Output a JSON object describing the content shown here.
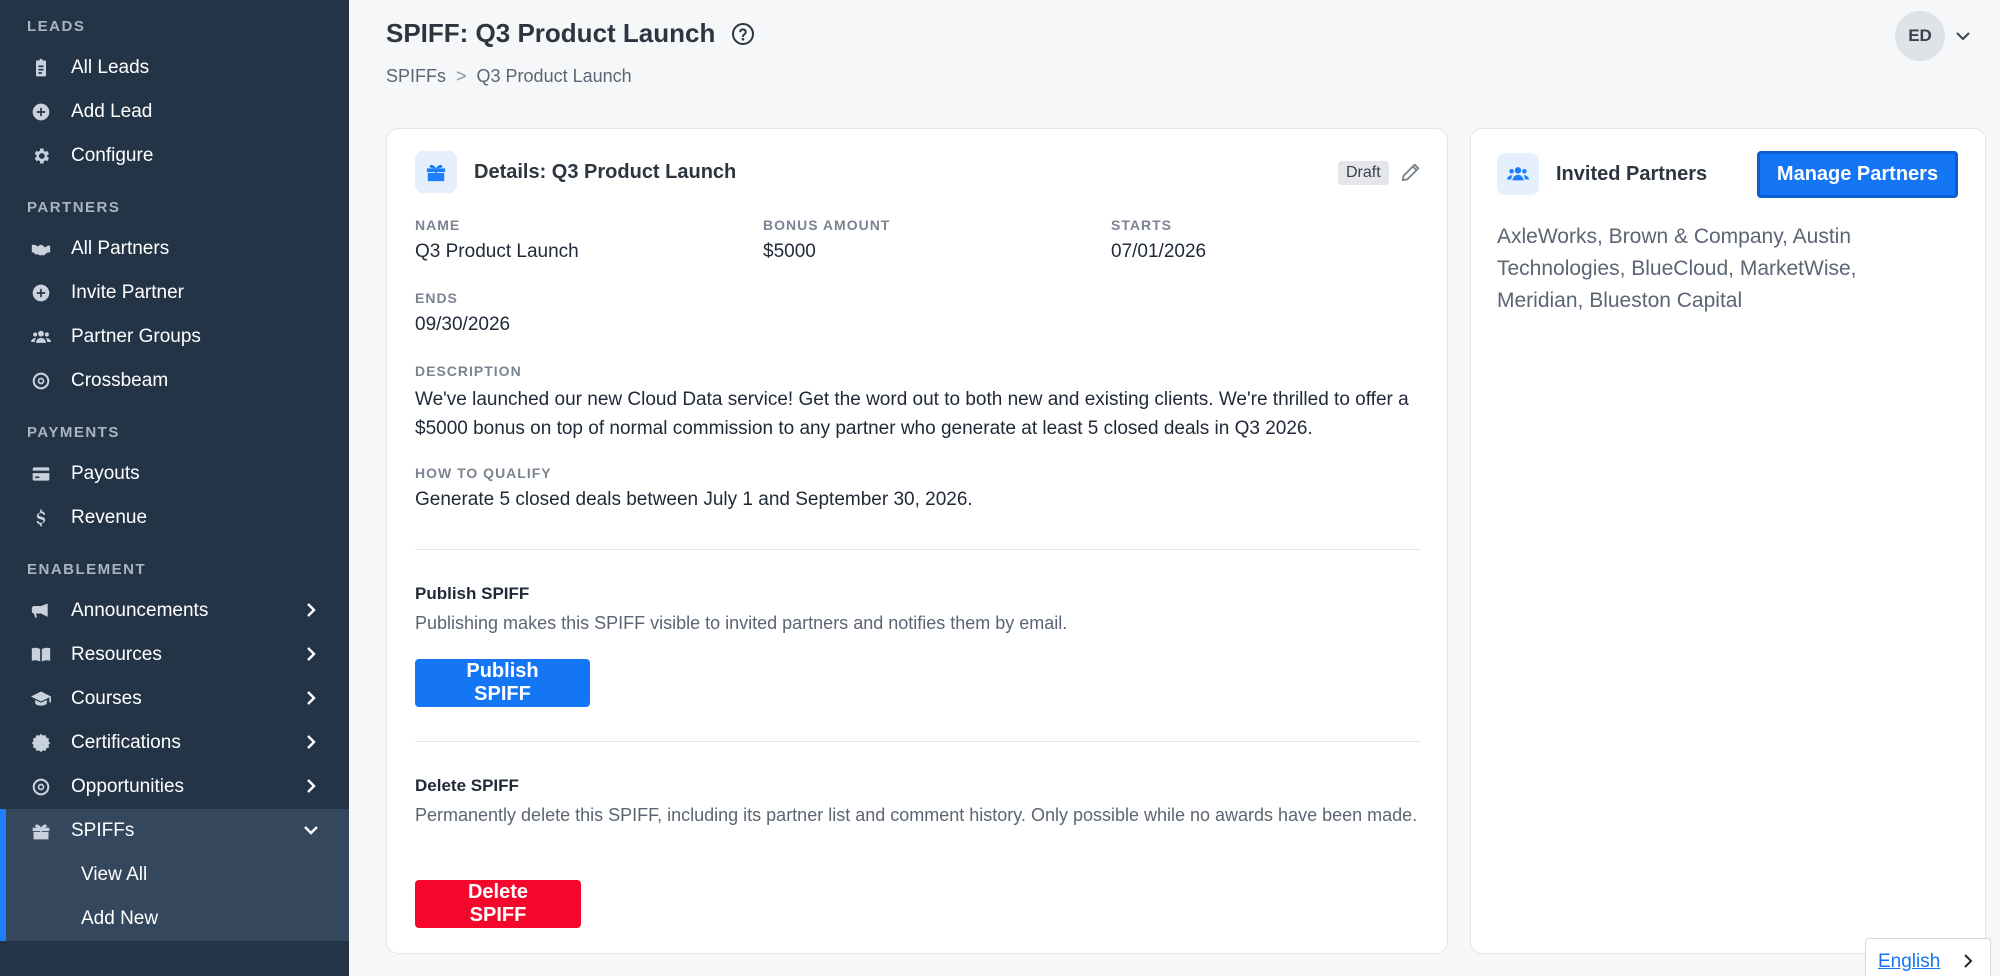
{
  "sidebar": {
    "sections": {
      "leads": "LEADS",
      "partners": "PARTNERS",
      "payments": "PAYMENTS",
      "enablement": "ENABLEMENT"
    },
    "items": {
      "all_leads": "All Leads",
      "add_lead": "Add Lead",
      "configure": "Configure",
      "all_partners": "All Partners",
      "invite_partner": "Invite Partner",
      "partner_groups": "Partner Groups",
      "crossbeam": "Crossbeam",
      "payouts": "Payouts",
      "revenue": "Revenue",
      "announcements": "Announcements",
      "resources": "Resources",
      "courses": "Courses",
      "certifications": "Certifications",
      "opportunities": "Opportunities",
      "spiffs": "SPIFFs",
      "view_all": "View All",
      "add_new": "Add New"
    }
  },
  "header": {
    "title": "SPIFF: Q3 Product Launch",
    "breadcrumb": [
      "SPIFFs",
      ">",
      "Q3 Product Launch"
    ],
    "avatar_initials": "ED"
  },
  "details": {
    "title": "Details: Q3 Product Launch",
    "badge": "Draft",
    "name_label": "NAME",
    "name_value": "Q3 Product Launch",
    "bonus_label": "BONUS AMOUNT",
    "bonus_value": "$5000",
    "starts_label": "STARTS",
    "starts_value": "07/01/2026",
    "ends_label": "ENDS",
    "ends_value": "09/30/2026",
    "description_label": "DESCRIPTION",
    "description_value": "We've launched our new Cloud Data service! Get the word out to both new and existing clients. We're thrilled to offer a $5000 bonus on top of normal commission to any partner who generate at least 5 closed deals in Q3 2026.",
    "qualify_label": "HOW TO QUALIFY",
    "qualify_value": "Generate 5 closed deals between July 1 and September 30, 2026."
  },
  "publish": {
    "heading": "Publish SPIFF",
    "text": "Publishing makes this SPIFF visible to invited partners and notifies them by email.",
    "button": "Publish SPIFF"
  },
  "delete": {
    "heading": "Delete SPIFF",
    "text": "Permanently delete this SPIFF, including its partner list and comment history. Only possible while no awards have been made.",
    "button": "Delete SPIFF"
  },
  "invited": {
    "title": "Invited Partners",
    "button": "Manage Partners",
    "partners": "AxleWorks, Brown & Company, Austin Technologies, BlueCloud, MarketWise, Meridian, Blueston Capital"
  },
  "language": "English",
  "colors": {
    "sidebar_bg": "#243447",
    "accent": "#1475f5",
    "danger": "#f5062b"
  }
}
